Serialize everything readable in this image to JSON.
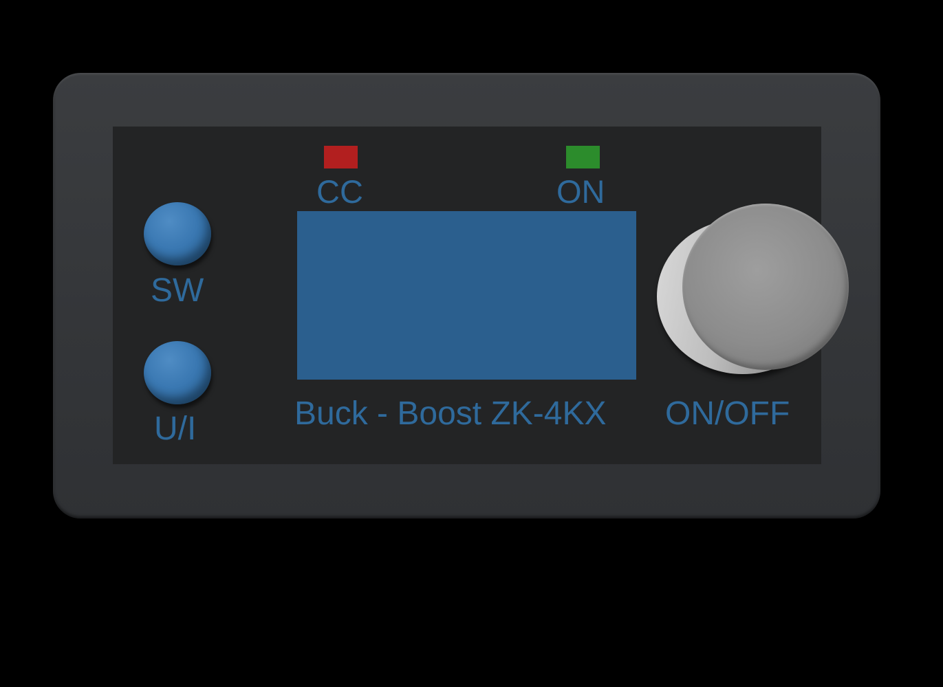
{
  "device": {
    "model_label": "Buck - Boost ZK-4KX",
    "colors": {
      "case": "#363839",
      "panel": "#232425",
      "label_text": "#2f6a9c",
      "display": "#2b5f8e",
      "button": "#3a78b2",
      "knob": "#8c8c8c"
    }
  },
  "indicators": {
    "cc": {
      "label": "CC",
      "color": "#b21f1f"
    },
    "on": {
      "label": "ON",
      "color": "#2c8c2c"
    }
  },
  "buttons": {
    "sw": {
      "label": "SW"
    },
    "ui": {
      "label": "U/I"
    }
  },
  "knob": {
    "label": "ON/OFF"
  }
}
